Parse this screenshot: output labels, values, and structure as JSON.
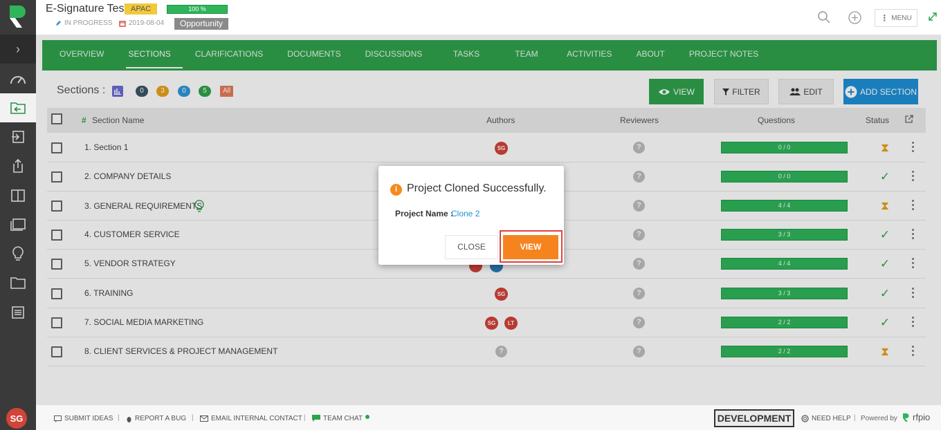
{
  "header": {
    "title": "E-Signature Test",
    "region_badge": "APAC",
    "progress_label": "100 %",
    "progress": 1.0,
    "status": "IN PROGRESS",
    "date": "2019-08-04",
    "type_badge": "Opportunity",
    "menu_label": "MENU"
  },
  "rail": {
    "items": [
      "dashboard-icon",
      "projects-icon",
      "import-icon",
      "export-icon",
      "library-icon",
      "copy-icon",
      "idea-icon",
      "folder-icon",
      "notes-icon"
    ],
    "avatar": "SG"
  },
  "tabs": [
    "OVERVIEW",
    "SECTIONS",
    "CLARIFICATIONS",
    "DOCUMENTS",
    "DISCUSSIONS",
    "TASKS",
    "TEAM",
    "ACTIVITIES",
    "ABOUT",
    "PROJECT NOTES"
  ],
  "sections_bar": {
    "label": "Sections :",
    "counts": [
      "0",
      "3",
      "0",
      "5",
      "All"
    ],
    "count_colors": [
      "#3c5566",
      "#e8a21a",
      "#2f97d6",
      "#2fa24c",
      "#e47b5a"
    ],
    "view_label": "VIEW",
    "filter_label": "FILTER",
    "edit_label": "EDIT",
    "add_label": "ADD SECTION"
  },
  "table": {
    "headers": {
      "name": "Section Name",
      "authors": "Authors",
      "reviewers": "Reviewers",
      "questions": "Questions",
      "status": "Status"
    },
    "rows": [
      {
        "name": "1. Section 1",
        "authors": [
          "SG"
        ],
        "questions": "0 / 0",
        "status": "pending"
      },
      {
        "name": "2. COMPANY DETAILS",
        "authors": [],
        "questions": "0 / 0",
        "status": "done"
      },
      {
        "name": "3. GENERAL REQUIREMENTS",
        "authors": [],
        "questions": "4 / 4",
        "status": "pending"
      },
      {
        "name": "4. CUSTOMER SERVICE",
        "authors": [],
        "questions": "3 / 3",
        "status": "done"
      },
      {
        "name": "5. VENDOR STRATEGY",
        "authors": [],
        "questions": "4 / 4",
        "status": "done"
      },
      {
        "name": "6. TRAINING",
        "authors": [
          "SG"
        ],
        "questions": "3 / 3",
        "status": "done"
      },
      {
        "name": "7. SOCIAL MEDIA MARKETING",
        "authors": [
          "SG",
          "LT"
        ],
        "questions": "2 / 2",
        "status": "done"
      },
      {
        "name": "8. CLIENT SERVICES & PROJECT MANAGEMENT",
        "authors": [],
        "questions": "2 / 2",
        "status": "pending"
      }
    ]
  },
  "dialog": {
    "title": "Project Cloned Successfully.",
    "label": "Project Name :",
    "value": "Clone 2",
    "close_label": "CLOSE",
    "view_label": "VIEW"
  },
  "footer": {
    "submit_ideas": "SUBMIT IDEAS",
    "report_bug": "REPORT A BUG",
    "email_contact": "EMAIL INTERNAL CONTACT",
    "team_chat": "TEAM CHAT",
    "environment": "DEVELOPMENT",
    "need_help": "NEED HELP",
    "powered_by": "Powered by",
    "brand": "rfpio"
  },
  "colors": {
    "green": "#2fa24c",
    "accent_orange": "#f5841f",
    "blue": "#1e90d6",
    "red": "#d24338"
  }
}
